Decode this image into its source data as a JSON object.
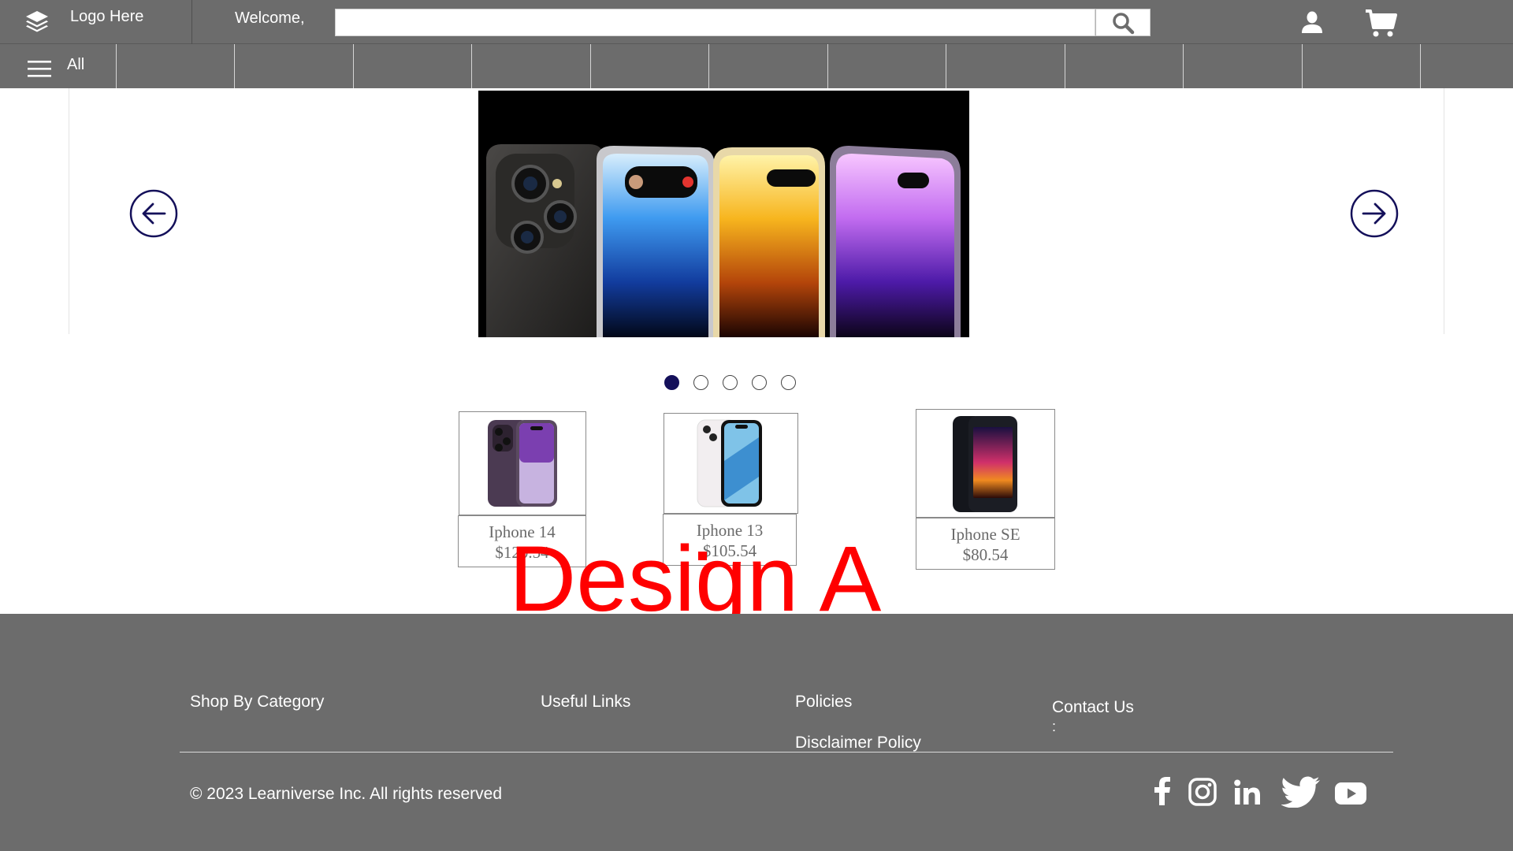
{
  "header": {
    "logo_text": "Logo Here",
    "welcome_text": "Welcome,",
    "search": {
      "value": "",
      "placeholder": ""
    },
    "icons": {
      "logo": "layers-icon",
      "search": "search-icon",
      "user": "user-icon",
      "cart": "cart-icon"
    }
  },
  "nav": {
    "all_label": "All",
    "menu_icon": "hamburger-menu-icon",
    "empty_slots": 12
  },
  "carousel": {
    "hero_image": "iphone-14-lineup-banner",
    "prev_icon": "arrow-left-circle-icon",
    "next_icon": "arrow-right-circle-icon",
    "slide_count": 5,
    "active_slide": 1
  },
  "products": [
    {
      "name": "Iphone 14",
      "price": "$120.54",
      "image": "iphone-14-pro-purple"
    },
    {
      "name": "Iphone 13",
      "price": "$105.54",
      "image": "iphone-13-blue"
    },
    {
      "name": "Iphone SE",
      "price": "$80.54",
      "image": "iphone-se-midnight"
    }
  ],
  "overlay": {
    "title": "Design A",
    "color": "#ff0000"
  },
  "footer": {
    "columns": {
      "shop": "Shop By Category",
      "useful": "Useful Links",
      "policies": "Policies",
      "contact": "Contact Us",
      "contact_detail": ":"
    },
    "policies_links": [
      "Disclaimer Policy"
    ],
    "copyright": "© 2023 Learniverse Inc. All rights reserved",
    "social_icons": [
      "facebook-icon",
      "instagram-icon",
      "linkedin-icon",
      "twitter-icon",
      "youtube-icon"
    ]
  },
  "colors": {
    "header_bg": "#6c6c6c",
    "footer_bg": "#6c6c6c",
    "accent_navy": "#14105a",
    "overlay_red": "#ff0000",
    "text_light": "#ffffff"
  }
}
